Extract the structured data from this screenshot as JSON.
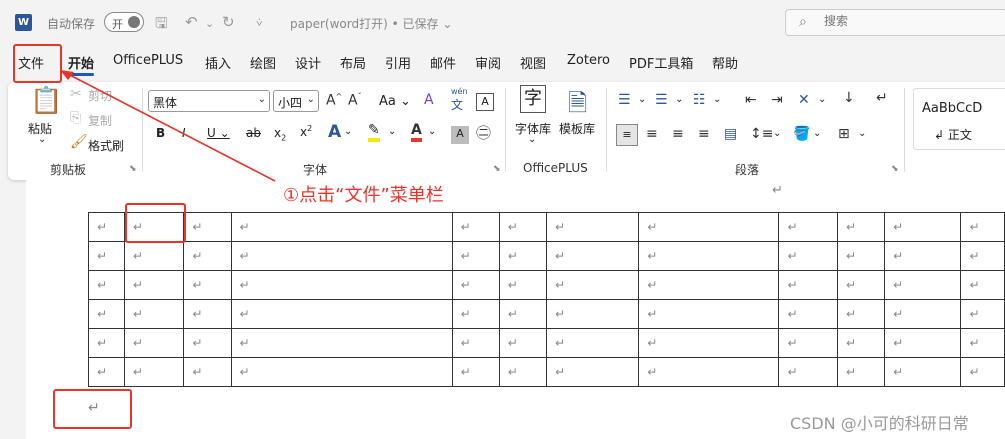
{
  "titlebar": {
    "app_logo": "W",
    "autosave_label": "自动保存",
    "toggle_label": "开",
    "document_title": "paper(word打开) • 已保存",
    "search_placeholder": "搜索"
  },
  "tabs": [
    "文件",
    "开始",
    "OfficePLUS",
    "插入",
    "绘图",
    "设计",
    "布局",
    "引用",
    "邮件",
    "审阅",
    "视图",
    "Zotero",
    "PDF工具箱",
    "帮助"
  ],
  "active_tab": "开始",
  "ribbon": {
    "clipboard": {
      "paste": "粘贴",
      "cut": "剪切",
      "copy": "复制",
      "format_painter": "格式刷",
      "group_label": "剪贴板"
    },
    "font": {
      "font_name": "黑体",
      "font_size": "小四",
      "group_label": "字体",
      "aa_label": "Aa",
      "pinyin": "wén",
      "pinyin_char": "文",
      "border_char": "A"
    },
    "officeplus": {
      "font_lib": "字体库",
      "template_lib": "模板库",
      "group_label": "OfficePLUS",
      "font_lib_icon": "字"
    },
    "paragraph": {
      "group_label": "段落"
    },
    "styles": {
      "sample": "AaBbCcD",
      "style_name": "正文"
    }
  },
  "annotation": {
    "text": "①点击“文件”菜单栏",
    "color": "#e8342a"
  },
  "watermark": "CSDN @小可的科研日常",
  "para_mark": "↵"
}
